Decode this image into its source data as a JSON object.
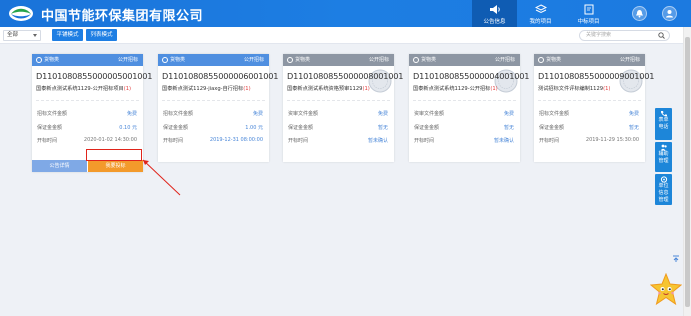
{
  "header": {
    "brand": "中国节能环保集团有限公司",
    "nav": [
      {
        "label": "公告信息",
        "icon": "speaker-icon",
        "active": true
      },
      {
        "label": "我的项目",
        "icon": "layers-icon",
        "active": false
      },
      {
        "label": "中标项目",
        "icon": "flag-icon",
        "active": false
      }
    ]
  },
  "toolbar": {
    "filter_value": "全部",
    "buttons": [
      "平铺模式",
      "列表模式"
    ],
    "search_placeholder": "关键字搜索"
  },
  "cards": [
    {
      "type": "货物类",
      "tag": "公开招标",
      "code": "D1101080855000005001001",
      "title": "国泰新点测试系统1129-公开招标项目",
      "flag": "(1)",
      "fields": [
        {
          "label": "招标文件金额",
          "value": "免费"
        },
        {
          "label": "保证金金额",
          "value": "0.10 元"
        },
        {
          "label": "开标时间",
          "value": "2020-01-02 14:30:00"
        }
      ],
      "buttons": [
        "公告详情",
        "我要投标"
      ]
    },
    {
      "type": "货物类",
      "tag": "公开招标",
      "code": "D1101080855000006001001",
      "title": "国泰新点测试1129-jiaxg-自行招标",
      "flag": "(1)",
      "fields": [
        {
          "label": "招标文件金额",
          "value": "免费"
        },
        {
          "label": "保证金金额",
          "value": "1.00 元"
        },
        {
          "label": "开标时间",
          "value": "2019-12-31 08:00:00"
        }
      ]
    },
    {
      "type": "货物类",
      "tag": "公开招标",
      "code": "D1101080855000008001001",
      "title": "国泰新点测试系统资格预审1129",
      "flag": "(1)",
      "fields": [
        {
          "label": "资审文件金额",
          "value": "免费"
        },
        {
          "label": "保证金金额",
          "value": "暂无"
        },
        {
          "label": "开标时间",
          "value": "暂未确认"
        }
      ]
    },
    {
      "type": "货物类",
      "tag": "公开招标",
      "code": "D1101080855000004001001",
      "title": "国泰新点测试系统1129-公开招标",
      "flag": "(1)",
      "fields": [
        {
          "label": "资审文件金额",
          "value": "免费"
        },
        {
          "label": "保证金金额",
          "value": "暂无"
        },
        {
          "label": "开标时间",
          "value": "暂未确认"
        }
      ]
    },
    {
      "type": "货物类",
      "tag": "公开招标",
      "code": "D1101080855000009001001",
      "title": "测试招标文件评标编制1129",
      "flag": "(1)",
      "fields": [
        {
          "label": "招标文件金额",
          "value": "免费"
        },
        {
          "label": "保证金金额",
          "value": "暂无"
        },
        {
          "label": "开标时间",
          "value": "2019-11-29 15:30:00"
        }
      ]
    }
  ],
  "side_panel": [
    {
      "label": "表单\n电话",
      "icon": "phone-icon"
    },
    {
      "label": "辅助\n管理",
      "icon": "people-icon"
    },
    {
      "label": "单位\n信息\n管理",
      "icon": "gear-icon"
    }
  ],
  "colors": {
    "header": "#1d7ee3",
    "accent": "#1e7ee3",
    "orange": "#f39a2b",
    "red": "#e03b3b"
  }
}
